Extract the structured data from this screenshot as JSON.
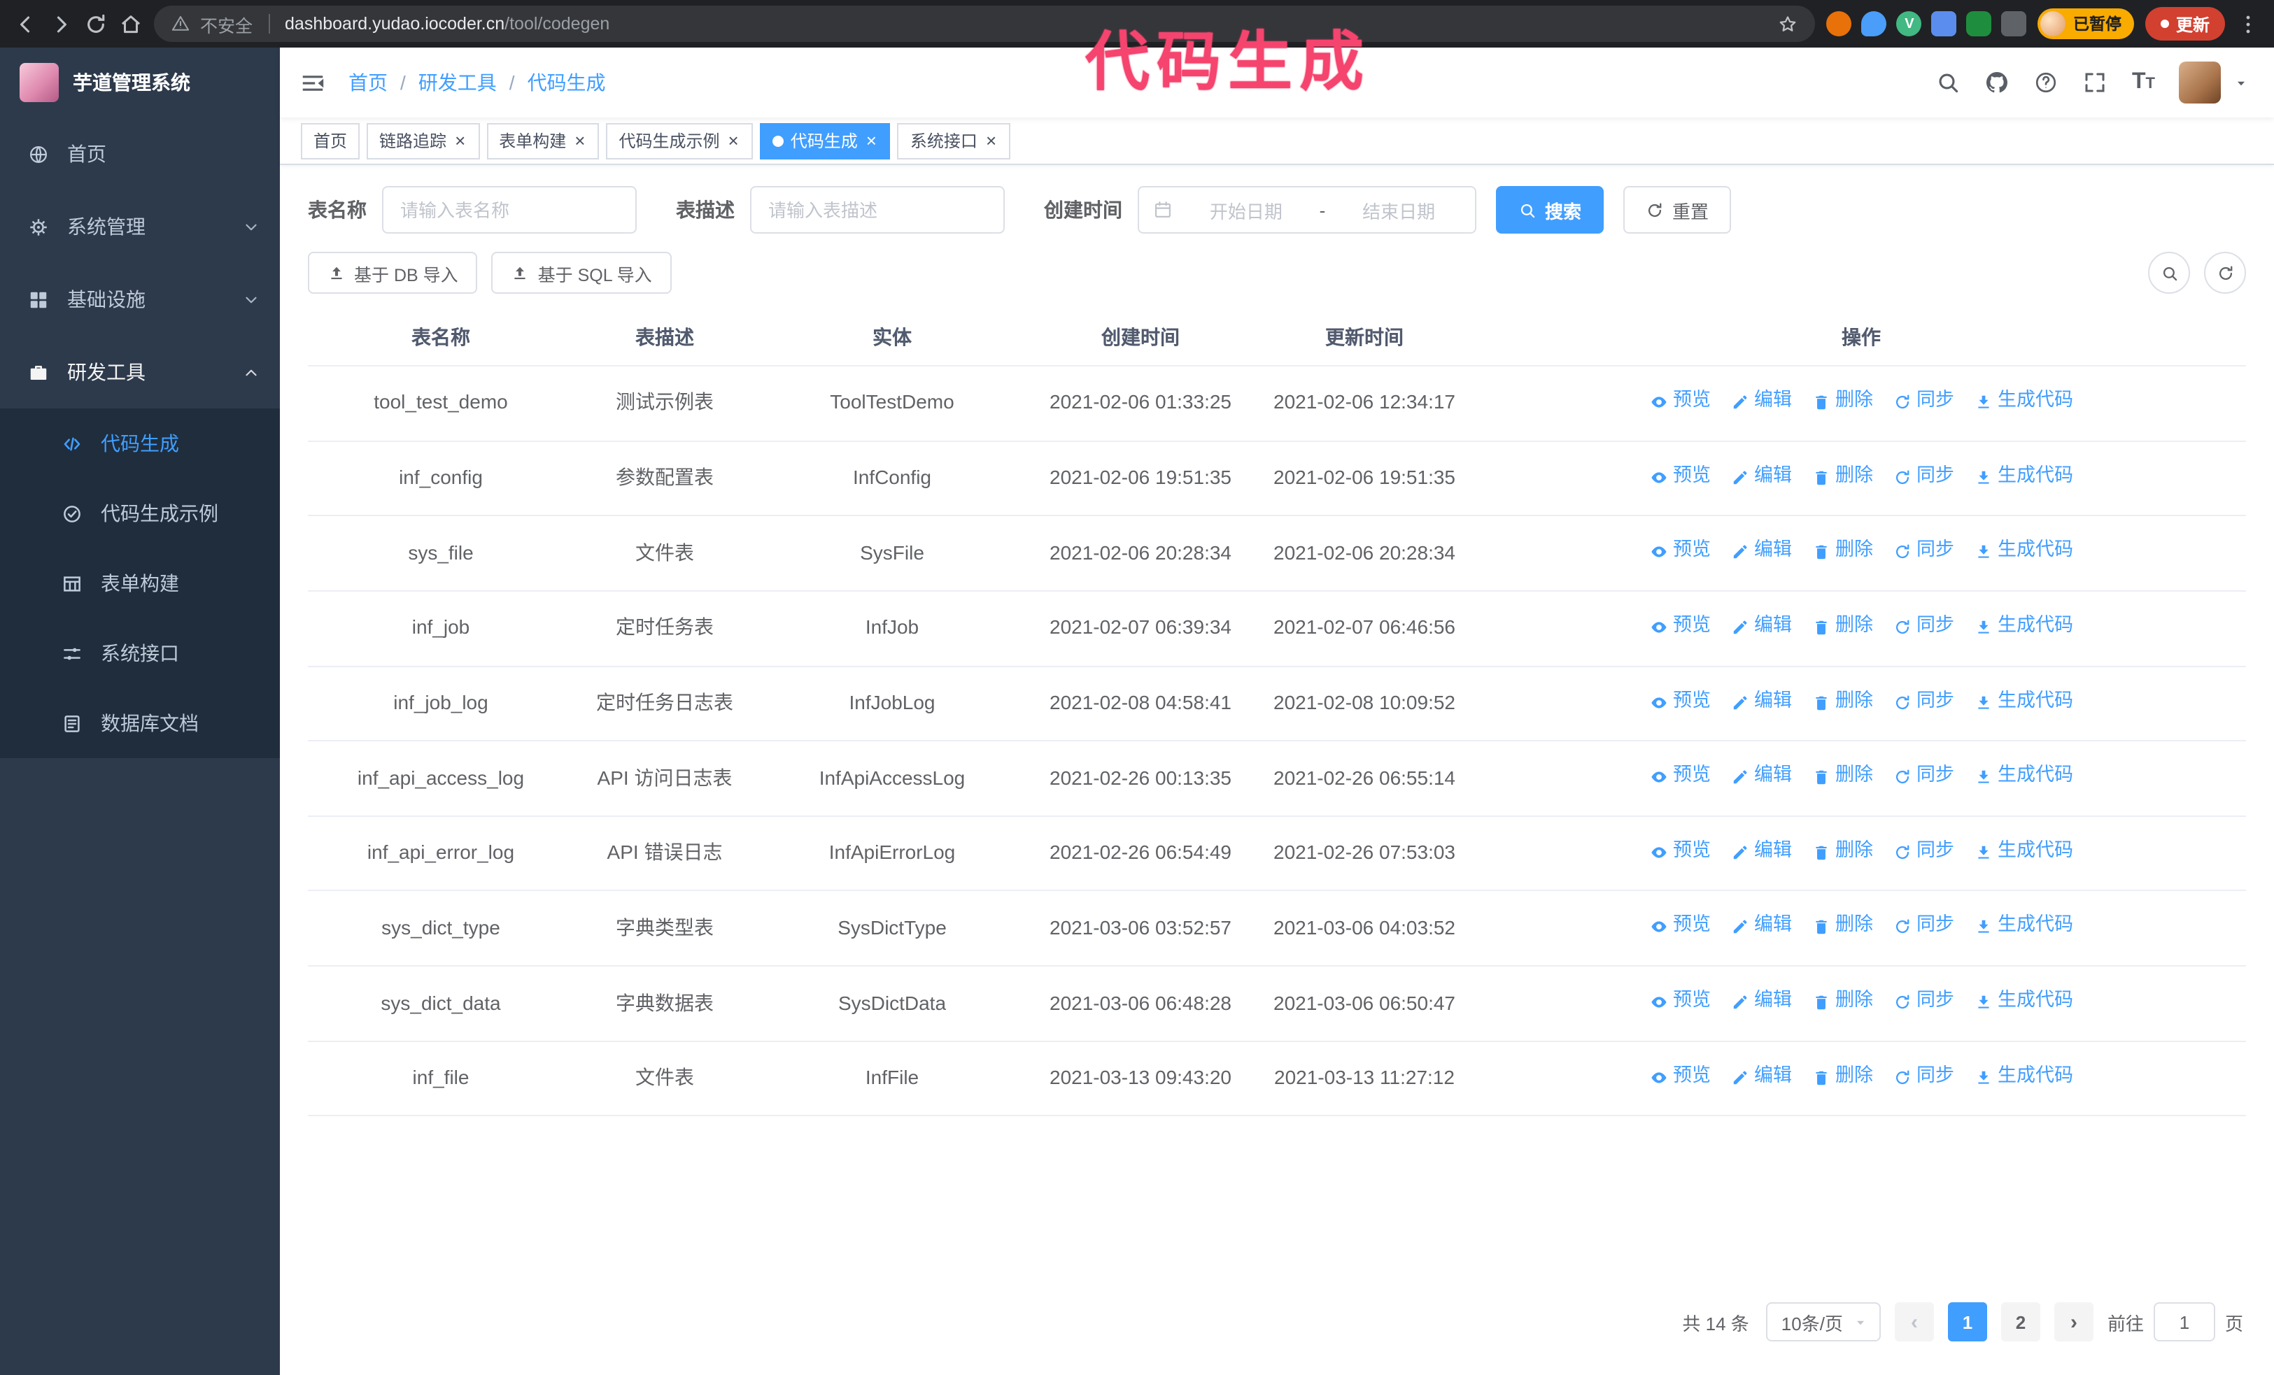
{
  "colors": {
    "accent": "#409EFF",
    "annotation": "#f5446e",
    "sidebar_bg": "#2d3a4b"
  },
  "browser": {
    "security_label": "不安全",
    "url_host": "dashboard.yudao.iocoder.cn",
    "url_path": "/tool/codegen",
    "profile_badge": "已暂停",
    "update_button": "更新"
  },
  "annotation": {
    "text": "代码生成"
  },
  "sidebar": {
    "logo_title": "芋道管理系统",
    "items": [
      {
        "key": "home",
        "icon": "home-icon",
        "label": "首页",
        "arrow": ""
      },
      {
        "key": "system",
        "icon": "gear-icon",
        "label": "系统管理",
        "arrow": "down"
      },
      {
        "key": "infra",
        "icon": "infra-icon",
        "label": "基础设施",
        "arrow": "down"
      },
      {
        "key": "devtools",
        "icon": "tools-icon",
        "label": "研发工具",
        "arrow": "up",
        "expanded": true
      }
    ],
    "subitems": [
      {
        "key": "codegen",
        "icon": "code-icon",
        "label": "代码生成",
        "active": true
      },
      {
        "key": "codegen-demo",
        "icon": "demo-icon",
        "label": "代码生成示例",
        "active": false
      },
      {
        "key": "form-builder",
        "icon": "form-icon",
        "label": "表单构建",
        "active": false
      },
      {
        "key": "system-api",
        "icon": "api-icon",
        "label": "系统接口",
        "active": false
      },
      {
        "key": "db-doc",
        "icon": "database-icon",
        "label": "数据库文档",
        "active": false
      }
    ]
  },
  "header": {
    "breadcrumb": [
      "首页",
      "研发工具",
      "代码生成"
    ],
    "separator": "/"
  },
  "tabs": [
    {
      "key": "home",
      "label": "首页",
      "closable": false,
      "active": false
    },
    {
      "key": "tracer",
      "label": "链路追踪",
      "closable": true,
      "active": false
    },
    {
      "key": "form-builder",
      "label": "表单构建",
      "closable": true,
      "active": false
    },
    {
      "key": "codegen-demo",
      "label": "代码生成示例",
      "closable": true,
      "active": false
    },
    {
      "key": "codegen",
      "label": "代码生成",
      "closable": true,
      "active": true
    },
    {
      "key": "system-api",
      "label": "系统接口",
      "closable": true,
      "active": false
    }
  ],
  "filters": {
    "table_name_label": "表名称",
    "table_name_placeholder": "请输入表名称",
    "table_desc_label": "表描述",
    "table_desc_placeholder": "请输入表描述",
    "create_time_label": "创建时间",
    "date_start_placeholder": "开始日期",
    "date_separator": "-",
    "date_end_placeholder": "结束日期",
    "search_button": "搜索",
    "reset_button": "重置"
  },
  "toolbar": {
    "import_db_button": "基于 DB 导入",
    "import_sql_button": "基于 SQL 导入"
  },
  "table": {
    "columns": [
      "表名称",
      "表描述",
      "实体",
      "创建时间",
      "更新时间",
      "操作"
    ],
    "actions": [
      {
        "key": "preview",
        "label": "预览"
      },
      {
        "key": "edit",
        "label": "编辑"
      },
      {
        "key": "delete",
        "label": "删除"
      },
      {
        "key": "sync",
        "label": "同步"
      },
      {
        "key": "generate",
        "label": "生成代码"
      }
    ],
    "rows": [
      {
        "name": "tool_test_demo",
        "desc": "测试示例表",
        "entity": "ToolTestDemo",
        "created": "2021-02-06 01:33:25",
        "updated": "2021-02-06 12:34:17"
      },
      {
        "name": "inf_config",
        "desc": "参数配置表",
        "entity": "InfConfig",
        "created": "2021-02-06 19:51:35",
        "updated": "2021-02-06 19:51:35"
      },
      {
        "name": "sys_file",
        "desc": "文件表",
        "entity": "SysFile",
        "created": "2021-02-06 20:28:34",
        "updated": "2021-02-06 20:28:34"
      },
      {
        "name": "inf_job",
        "desc": "定时任务表",
        "entity": "InfJob",
        "created": "2021-02-07 06:39:34",
        "updated": "2021-02-07 06:46:56"
      },
      {
        "name": "inf_job_log",
        "desc": "定时任务日志表",
        "entity": "InfJobLog",
        "created": "2021-02-08 04:58:41",
        "updated": "2021-02-08 10:09:52"
      },
      {
        "name": "inf_api_access_log",
        "desc": "API 访问日志表",
        "entity": "InfApiAccessLog",
        "created": "2021-02-26 00:13:35",
        "updated": "2021-02-26 06:55:14"
      },
      {
        "name": "inf_api_error_log",
        "desc": "API 错误日志",
        "entity": "InfApiErrorLog",
        "created": "2021-02-26 06:54:49",
        "updated": "2021-02-26 07:53:03"
      },
      {
        "name": "sys_dict_type",
        "desc": "字典类型表",
        "entity": "SysDictType",
        "created": "2021-03-06 03:52:57",
        "updated": "2021-03-06 04:03:52"
      },
      {
        "name": "sys_dict_data",
        "desc": "字典数据表",
        "entity": "SysDictData",
        "created": "2021-03-06 06:48:28",
        "updated": "2021-03-06 06:50:47"
      },
      {
        "name": "inf_file",
        "desc": "文件表",
        "entity": "InfFile",
        "created": "2021-03-13 09:43:20",
        "updated": "2021-03-13 11:27:12"
      }
    ]
  },
  "pagination": {
    "total": "共 14 条",
    "page_size": "10条/页",
    "pages": [
      "1",
      "2"
    ],
    "active_page": "1",
    "prev_icon": "‹",
    "next_icon": "›",
    "goto_prefix": "前往",
    "goto_value": "1",
    "goto_suffix": "页"
  }
}
